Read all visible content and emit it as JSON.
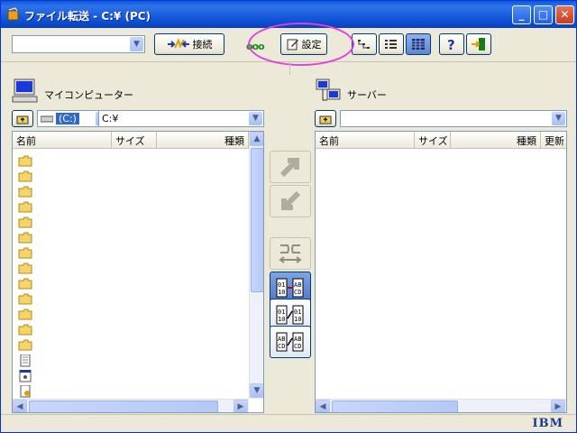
{
  "window": {
    "title": "ファイル転送 - C:¥ (PC)",
    "buttons": {
      "minimize": "_",
      "maximize": "□",
      "close": "✕"
    }
  },
  "toolbar": {
    "host_combo_value": "",
    "connect_label": "接続",
    "settings_label": "設定",
    "status_dots": "ooo"
  },
  "left_panel": {
    "title": "マイコンピューター",
    "drive_label": "(C:)",
    "path_value": "C:¥",
    "columns": [
      "名前",
      "サイズ",
      "種類"
    ],
    "items": [
      "folder",
      "folder",
      "folder",
      "folder",
      "folder",
      "folder",
      "folder",
      "folder",
      "folder",
      "folder",
      "folder",
      "folder",
      "folder",
      "text-file",
      "system-file",
      "settings-file"
    ]
  },
  "right_panel": {
    "title": "サーバー",
    "path_value": "",
    "columns": [
      "名前",
      "サイズ",
      "種類",
      "更新"
    ]
  },
  "status": {
    "brand": "IBM"
  },
  "colors": {
    "titlebar": "#0a5bd8",
    "highlight_ring": "#e040e0",
    "selected_mode": "#5d86d1"
  }
}
